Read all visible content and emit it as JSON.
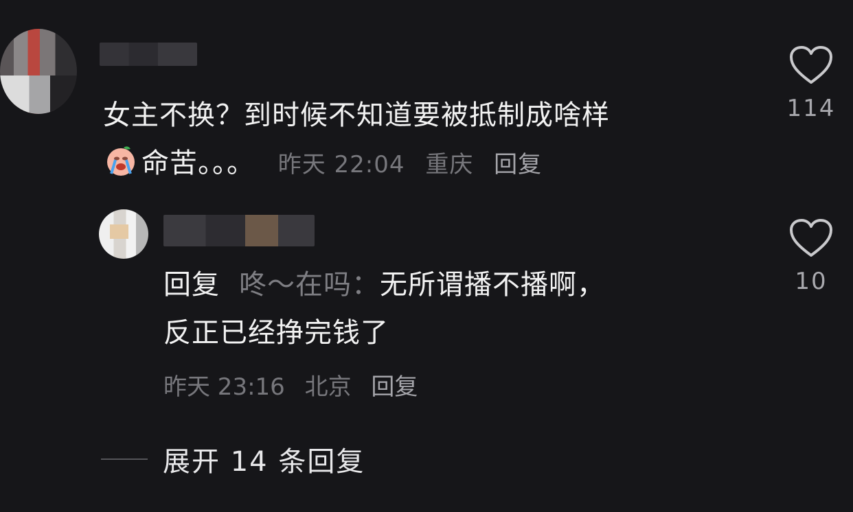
{
  "comments": {
    "main": {
      "text_line1": "女主不换？到时候不知道要被抵制成啥样",
      "text_line2": "命苦。。。",
      "emoji": "crying-face-emoji",
      "time": "昨天 22:04",
      "location": "重庆",
      "reply_label": "回复",
      "like_count": "114"
    },
    "reply": {
      "prefix": "回复",
      "target": "咚～在吗：",
      "text_line1": "无所谓播不播啊，",
      "text_line2": "反正已经挣完钱了",
      "time": "昨天 23:16",
      "location": "北京",
      "reply_label": "回复",
      "like_count": "10"
    }
  },
  "expand": {
    "label": "展开 14 条回复"
  },
  "icons": {
    "like": "heart-outline-icon"
  },
  "colors": {
    "background": "#161619",
    "text": "#f2f2f2",
    "meta": "#77777c"
  }
}
